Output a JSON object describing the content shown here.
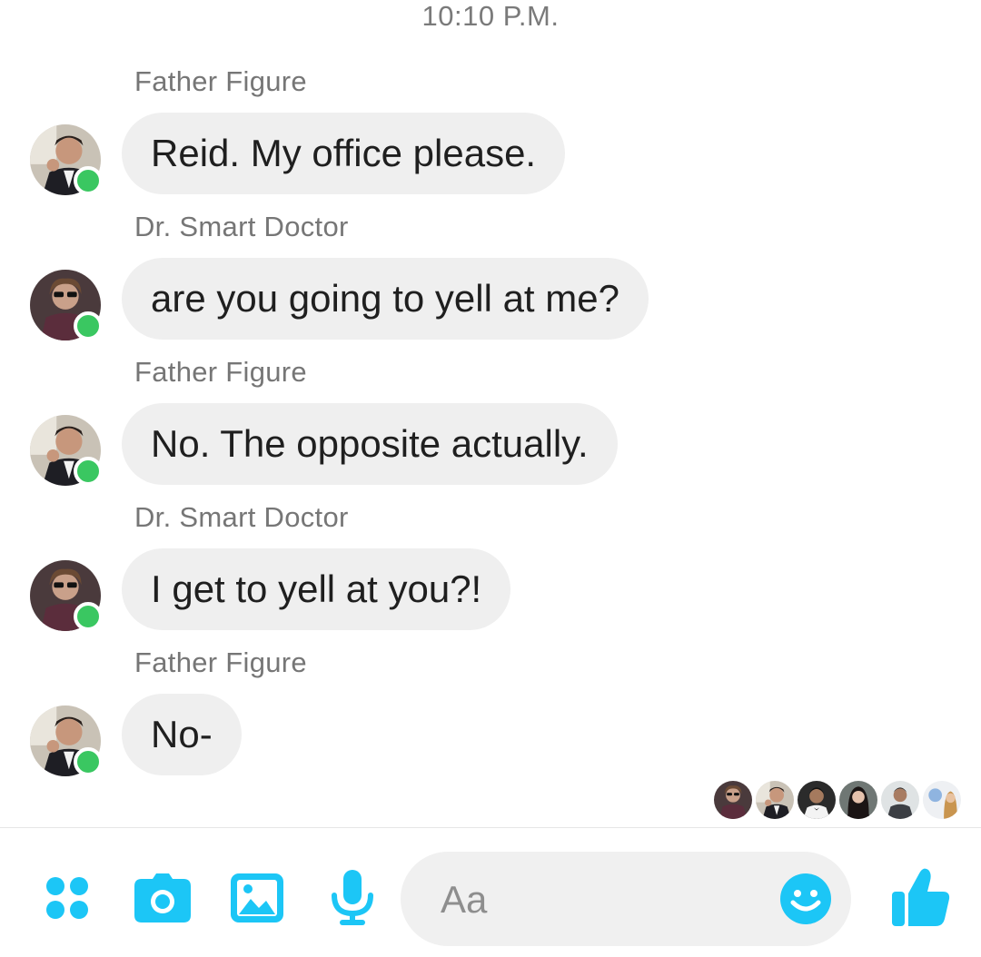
{
  "conversation": {
    "timestamp": "10:10 P.M.",
    "messages": [
      {
        "sender": "Father Figure",
        "text": "Reid. My office please.",
        "avatar": "father-figure-avatar"
      },
      {
        "sender": "Dr. Smart Doctor",
        "text": "are you going to yell at me?",
        "avatar": "dr-smart-doctor-avatar"
      },
      {
        "sender": "Father Figure",
        "text": "No. The opposite actually.",
        "avatar": "father-figure-avatar"
      },
      {
        "sender": "Dr. Smart Doctor",
        "text": "I get to yell at you?!",
        "avatar": "dr-smart-doctor-avatar"
      },
      {
        "sender": "Father Figure",
        "text": "No-",
        "avatar": "father-figure-avatar"
      }
    ],
    "seen_by_count": 6
  },
  "composer": {
    "placeholder": "Aa",
    "icons": [
      "apps-icon",
      "camera-icon",
      "image-icon",
      "microphone-icon",
      "emoji-icon",
      "thumbs-up-icon"
    ]
  },
  "colors": {
    "accent": "#1cc6f6",
    "bubble": "#efefef",
    "online": "#3ac761",
    "sender_text": "#767676"
  }
}
